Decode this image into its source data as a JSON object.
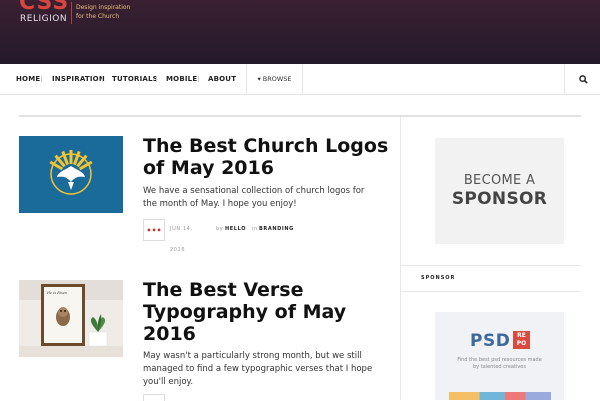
{
  "header": {
    "logo_word": "CSS",
    "logo_sub": "RELIGION",
    "tagline_1": "Design inspiration",
    "tagline_2": "for the Church"
  },
  "nav": {
    "items": [
      {
        "label": "HOME"
      },
      {
        "label": "INSPIRATION"
      },
      {
        "label": "TUTORIALS"
      },
      {
        "label": "MOBILE"
      },
      {
        "label": "ABOUT"
      }
    ],
    "browse_label": "▾ BROWSE",
    "search_icon": "search-icon"
  },
  "articles": [
    {
      "title_line1": "The Best Church Logos",
      "title_line2": "of May 2016",
      "excerpt_line1": "We have a sensational collection of church logos for",
      "excerpt_line2": "the month of May. I hope you enjoy!",
      "more_label": "•••",
      "date_line1": "JUN 14,",
      "date_line2": "2016",
      "by_label": "by",
      "author": "HELLO",
      "in_label": "in",
      "category": "BRANDING"
    },
    {
      "title_line1": "The Best Verse",
      "title_line2": "Typography of May",
      "title_line3": "2016",
      "excerpt_line1": "May wasn't a particularly strong month, but we still",
      "excerpt_line2": "managed to find a few typographic verses that I hope",
      "excerpt_line3": "you'll enjoy.",
      "thumb_caption": "He is Risen"
    }
  ],
  "sidebar": {
    "sponsor_line1": "BECOME A",
    "sponsor_line2": "SPONSOR",
    "section_label": "SPONSOR",
    "psd_logo": "PSD",
    "psd_badge_1": "RE",
    "psd_badge_2": "PO",
    "psd_caption_1": "Find the best psd resources made",
    "psd_caption_2": "by talented creatives"
  },
  "colors": {
    "accent_red": "#d6453f",
    "header_bg": "#2b1e2e",
    "thumb_blue": "#1a6a9a",
    "thumb_yellow": "#f4c430",
    "psd_blue": "#3d6a9c"
  }
}
